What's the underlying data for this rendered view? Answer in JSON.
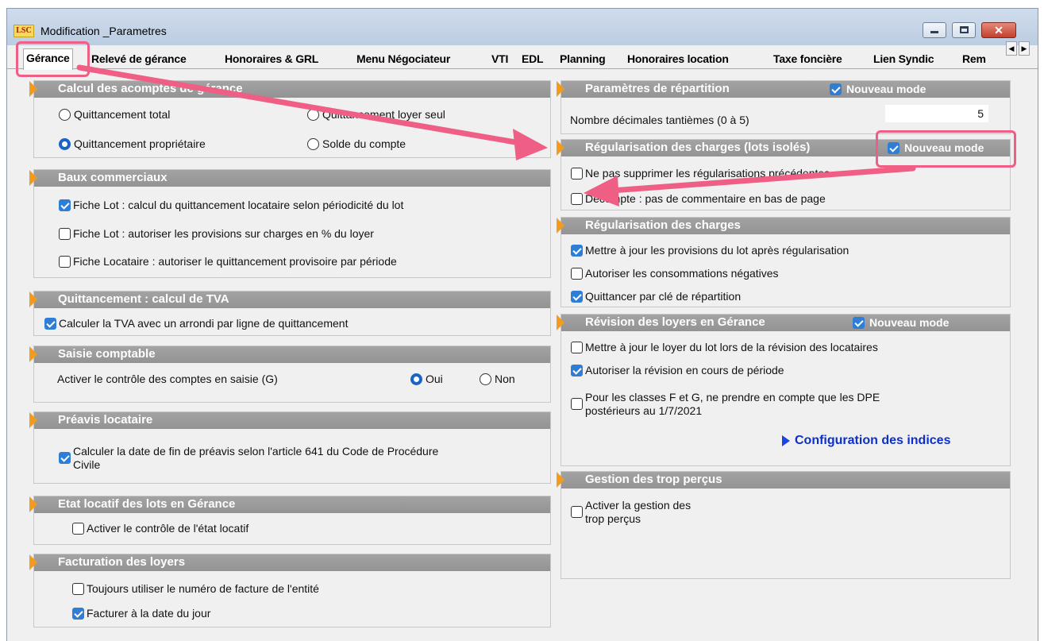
{
  "window": {
    "title": "Modification _Parametres",
    "logo_text": "LSC"
  },
  "window_buttons": {
    "minimize": "minimize-icon",
    "maximize": "maximize-icon",
    "close": "✕"
  },
  "tabs": [
    "Gérance",
    "Relevé de gérance",
    "Honoraires & GRL",
    "Menu Négociateur",
    "VTI",
    "EDL",
    "Planning",
    "Honoraires location",
    "Taxe foncière",
    "Lien Syndic",
    "Rem"
  ],
  "tab_arrows": {
    "left": "◀",
    "right": "▶"
  },
  "colors": {
    "header_bg": "#9b9b9b",
    "chevron": "#f39b1f",
    "check_blue": "#2f7ed6",
    "link": "#0c2fcc",
    "highlight": "#ef5f85"
  },
  "left": {
    "calcul": {
      "title": "Calcul des acomptes de gérance",
      "opt1": "Quittancement total",
      "opt2": "Quittancement loyer seul",
      "opt3": "Quittancement propriétaire",
      "opt4": "Solde du compte",
      "selected": "Quittancement propriétaire"
    },
    "baux": {
      "title": "Baux commerciaux",
      "opt1": "Fiche Lot : calcul du quittancement locataire selon périodicité du lot",
      "opt2": "Fiche Lot : autoriser les provisions sur charges en % du loyer",
      "opt3": "Fiche Locataire : autoriser le quittancement provisoire par période"
    },
    "tva": {
      "title": "Quittancement : calcul de TVA",
      "opt1": "Calculer la TVA avec un arrondi par ligne de quittancement"
    },
    "saisie": {
      "title": "Saisie comptable",
      "label": "Activer le contrôle des comptes en saisie (G)",
      "oui": "Oui",
      "non": "Non",
      "selected": "Oui"
    },
    "preavis": {
      "title": "Préavis locataire",
      "line1": "Calculer la date de fin de préavis selon l'article 641 du Code de Procédure",
      "line2": "Civile"
    },
    "etat": {
      "title": "Etat locatif des lots en Gérance",
      "opt1": "Activer le contrôle de l'état locatif"
    },
    "facturation": {
      "title": "Facturation des loyers",
      "opt1": "Toujours utiliser le numéro de facture de l'entité",
      "opt2": "Facturer à la date du jour"
    }
  },
  "right": {
    "repartition": {
      "title": "Paramètres de répartition",
      "mode": "Nouveau mode",
      "decimals_label": "Nombre décimales tantièmes (0 à 5)",
      "decimals_value": "5"
    },
    "regul_isoles": {
      "title": "Régularisation des charges (lots isolés)",
      "mode": "Nouveau mode",
      "opt1": "Ne pas supprimer les régularisations précédentes",
      "opt2": "Décompte : pas de commentaire en bas de page"
    },
    "regul": {
      "title": "Régularisation des charges",
      "opt1": "Mettre à jour les provisions du lot après régularisation",
      "opt2": "Autoriser les consommations négatives",
      "opt3": "Quittancer par clé de répartition"
    },
    "revision": {
      "title": "Révision des loyers en Gérance",
      "mode": "Nouveau mode",
      "opt1": "Mettre à jour le loyer du lot lors de la révision des locataires",
      "opt2": "Autoriser la révision en cours de période",
      "opt3_line1": "Pour les classes F et G, ne prendre en compte que les DPE",
      "opt3_line2": "postérieurs au 1/7/2021",
      "link": "Configuration des indices"
    },
    "trop": {
      "title": "Gestion des trop perçus",
      "opt1_line1": "Activer la gestion des",
      "opt1_line2": "trop perçus"
    }
  }
}
